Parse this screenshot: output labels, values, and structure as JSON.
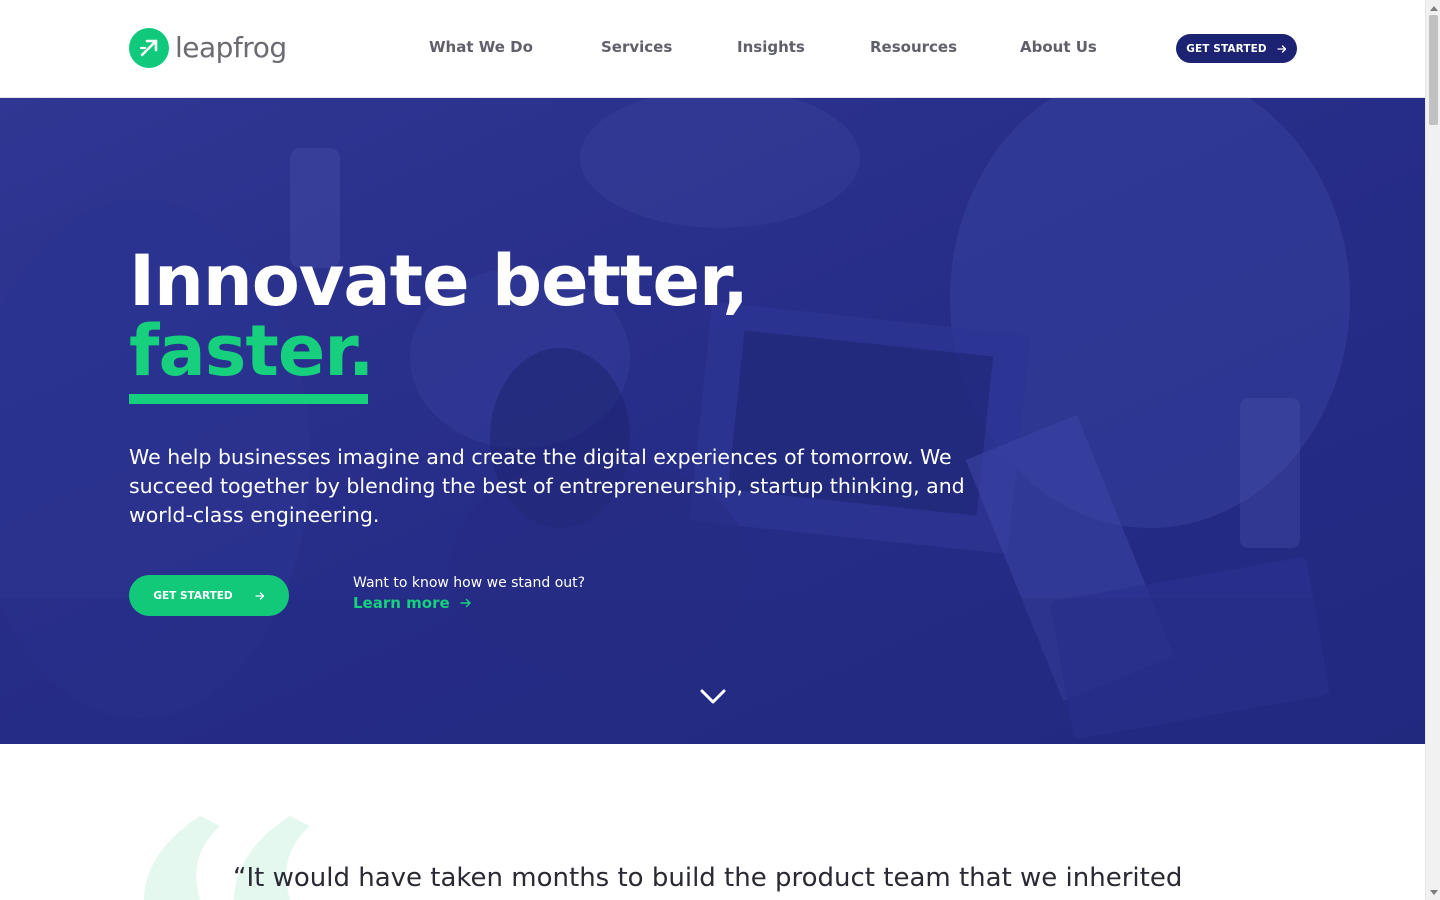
{
  "brand": {
    "name": "leapfrog",
    "accent": "#16d07e",
    "navy": "#1c2373",
    "hero_overlay": "#262d8a"
  },
  "nav": {
    "items": [
      "What We Do",
      "Services",
      "Insights",
      "Resources",
      "About Us"
    ],
    "cta_label": "GET STARTED"
  },
  "hero": {
    "title_line1": "Innovate better,",
    "title_line2": "faster.",
    "description": "We help businesses imagine and create the digital experiences of tomorrow. We succeed together by blending the best of entrepreneurship, startup thinking, and world-class engineering.",
    "cta_label": "GET STARTED",
    "standout_question": "Want to know how we stand out?",
    "learn_more_label": "Learn more"
  },
  "testimonial": {
    "quote_start": "“It would have taken months to build the product team that we inherited"
  },
  "icons": {
    "logo": "leapfrog-logo-icon",
    "arrow": "arrow-right-icon",
    "scroll": "chevron-down-icon",
    "quote": "quote-mark-icon"
  }
}
